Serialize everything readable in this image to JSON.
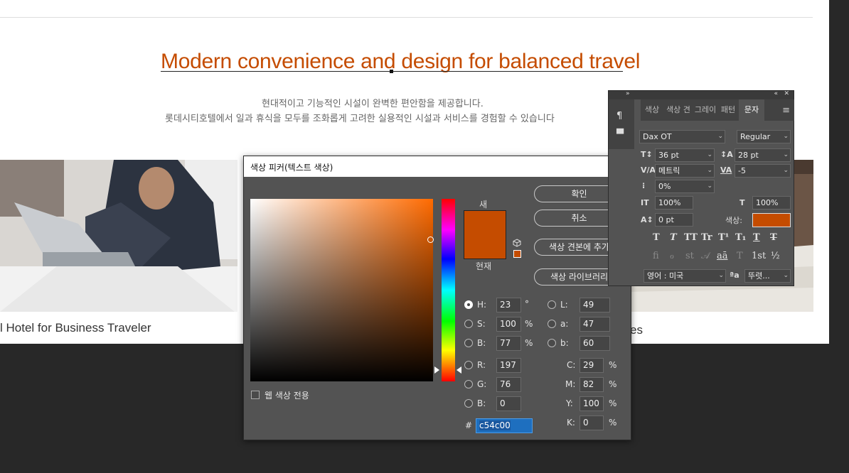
{
  "page": {
    "headline": "Modern convenience and design for balanced travel",
    "desc_line1": "현대적이고 기능적인 시설이 완벽한 편안함을 제공합니다.",
    "desc_line2": "롯데시티호텔에서 일과 휴식을 모두를 조화롭게 고려한 실용적인 시설과 서비스를 경험할 수 있습니다",
    "caption_left": "l Hotel for Business Traveler",
    "caption_right": "es"
  },
  "color_picker": {
    "title": "색상 피커(텍스트 색상)",
    "close_glyph": "✕",
    "label_new": "새",
    "label_current": "현재",
    "buttons": {
      "ok": "확인",
      "cancel": "취소",
      "add_to_swatches": "색상 견본에 추가",
      "color_libraries": "색상 라이브러리"
    },
    "hsb": {
      "h": {
        "label": "H:",
        "value": "23",
        "unit": "°"
      },
      "s": {
        "label": "S:",
        "value": "100",
        "unit": "%"
      },
      "b": {
        "label": "B:",
        "value": "77",
        "unit": "%"
      }
    },
    "lab": {
      "l": {
        "label": "L:",
        "value": "49"
      },
      "a": {
        "label": "a:",
        "value": "47"
      },
      "b": {
        "label": "b:",
        "value": "60"
      }
    },
    "rgb": {
      "r": {
        "label": "R:",
        "value": "197"
      },
      "g": {
        "label": "G:",
        "value": "76"
      },
      "b": {
        "label": "B:",
        "value": "0"
      }
    },
    "cmyk": {
      "c": {
        "label": "C:",
        "value": "29",
        "unit": "%"
      },
      "m": {
        "label": "M:",
        "value": "82",
        "unit": "%"
      },
      "y": {
        "label": "Y:",
        "value": "100",
        "unit": "%"
      },
      "k": {
        "label": "K:",
        "value": "0",
        "unit": "%"
      }
    },
    "hex_label": "#",
    "hex_value": "c54c00",
    "selected_mode": "H",
    "web_colors_only_label": "웹 색상 전용",
    "web_colors_only_checked": false,
    "new_color": "#c54c00",
    "current_color": "#c54c00",
    "hue_fraction": 0.936,
    "colors": {
      "dialog_bg": "#535353",
      "accent": "#c54c00"
    }
  },
  "character_panel": {
    "collapse_glyph": "»",
    "expand_glyph": "«",
    "close_glyph": "✕",
    "menu_glyph": "≡",
    "tabs": [
      "색상",
      "색상 견",
      "그레이",
      "패턴",
      "문자"
    ],
    "active_tab": "문자",
    "font_family": "Dax OT",
    "font_style": "Regular",
    "font_size": "36 pt",
    "leading": "28 pt",
    "kerning": "메트릭",
    "tracking": "-5",
    "tsume": "0%",
    "vertical_scale": "100%",
    "horizontal_scale": "100%",
    "baseline_shift": "0 pt",
    "color_label": "색상:",
    "color": "#c54c00",
    "language": "영어 : 미국",
    "antialias": "뚜렷...",
    "aa_icon_glyph": "ªa",
    "dropdown_glyph": "⌄",
    "type_styles": [
      "T",
      "T",
      "TT",
      "Tr",
      "T¹",
      "T₁",
      "T",
      "T"
    ],
    "opentype": [
      "fi",
      "ℴ",
      "st",
      "𝒜",
      "aā",
      "T",
      "1st",
      "½"
    ],
    "icons": {
      "size": "T↕",
      "leading": "↕A",
      "kerning": "V/A",
      "tracking": "VA",
      "tsume": "⁝",
      "vscale": "IT",
      "hscale": "T",
      "baseline": "A↕"
    }
  }
}
